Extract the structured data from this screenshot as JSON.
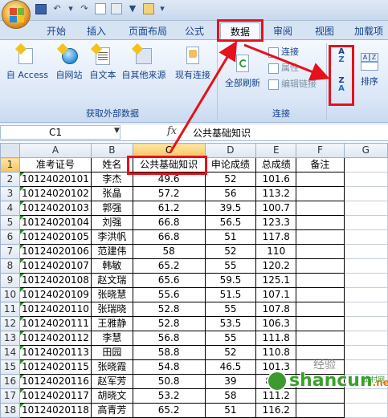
{
  "ribbon_tabs": [
    "开始",
    "插入",
    "页面布局",
    "公式",
    "数据",
    "审阅",
    "视图",
    "加载项"
  ],
  "active_tab": "数据",
  "external_data": {
    "buttons": [
      "自 Access",
      "自网站",
      "自文本",
      "自其他来源",
      "现有连接"
    ],
    "group_label": "获取外部数据"
  },
  "connections": {
    "refresh_all": "全部刷新",
    "connect": "连接",
    "properties": "属性",
    "edit_links": "编辑链接",
    "group_label": "连接"
  },
  "sort": {
    "sort_label": "排序",
    "az_top": "A",
    "az_bottom": "Z",
    "za_top": "Z",
    "za_bottom": "A"
  },
  "formula_bar": {
    "name_box": "C1",
    "fx": "fx",
    "content": "公共基础知识"
  },
  "columns": [
    "A",
    "B",
    "C",
    "D",
    "E",
    "F",
    "G"
  ],
  "headers": [
    "准考证号",
    "姓名",
    "公共基础知识",
    "申论成绩",
    "总成绩",
    "备注"
  ],
  "rows": [
    [
      "10124020101",
      "李杰",
      "49.6",
      "52",
      "101.6"
    ],
    [
      "10124020102",
      "张晶",
      "57.2",
      "56",
      "113.2"
    ],
    [
      "10124020103",
      "郭强",
      "61.2",
      "39.5",
      "100.7"
    ],
    [
      "10124020104",
      "刘强",
      "66.8",
      "56.5",
      "123.3"
    ],
    [
      "10124020105",
      "李洪帆",
      "66.8",
      "51",
      "117.8"
    ],
    [
      "10124020106",
      "范建伟",
      "58",
      "52",
      "110"
    ],
    [
      "10124020107",
      "韩敏",
      "65.2",
      "55",
      "120.2"
    ],
    [
      "10124020108",
      "赵文瑞",
      "65.6",
      "59.5",
      "125.1"
    ],
    [
      "10124020109",
      "张晓慧",
      "55.6",
      "51.5",
      "107.1"
    ],
    [
      "10124020110",
      "张瑞晓",
      "52.8",
      "55",
      "107.8"
    ],
    [
      "10124020111",
      "王雅静",
      "52.8",
      "53.5",
      "106.3"
    ],
    [
      "10124020112",
      "李慧",
      "56.8",
      "55",
      "111.8"
    ],
    [
      "10124020113",
      "田园",
      "58.8",
      "52",
      "110.8"
    ],
    [
      "10124020115",
      "张晓霞",
      "54.8",
      "46.5",
      "101.3"
    ],
    [
      "10124020116",
      "赵军芳",
      "50.8",
      "39",
      "89.8"
    ],
    [
      "10124020117",
      "胡晓文",
      "53.2",
      "58",
      "111.2"
    ],
    [
      "10124020118",
      "高青芳",
      "65.2",
      "51",
      "116.2"
    ]
  ],
  "watermark": {
    "brand": "shancun",
    "domain": ".net",
    "small": "山村网",
    "caption": "经验"
  },
  "colors": {
    "highlight": "#e8101a",
    "ribbon_text": "#15428b"
  }
}
